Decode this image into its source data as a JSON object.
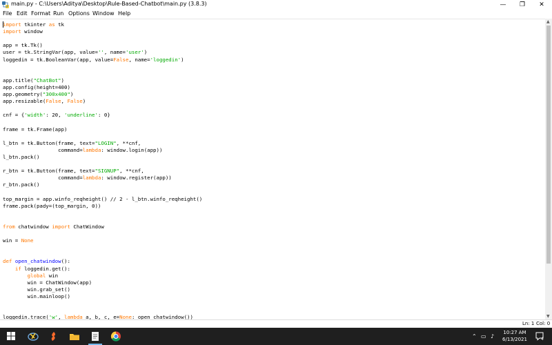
{
  "window": {
    "title": "main.py - C:\\Users\\Aditya\\Desktop\\Rule-Based-Chatbot\\main.py (3.8.3)",
    "minimize": "—",
    "maximize": "❐",
    "close": "✕"
  },
  "menu": [
    "File",
    "Edit",
    "Format",
    "Run",
    "Options",
    "Window",
    "Help"
  ],
  "code": [
    [
      {
        "t": "import",
        "c": "kw"
      },
      {
        "t": " tkinter "
      },
      {
        "t": "as",
        "c": "kw"
      },
      {
        "t": " tk"
      }
    ],
    [
      {
        "t": "import",
        "c": "kw"
      },
      {
        "t": " window"
      }
    ],
    [],
    [
      {
        "t": "app = tk.Tk()"
      }
    ],
    [
      {
        "t": "user = tk.StringVar(app, value="
      },
      {
        "t": "''",
        "c": "str"
      },
      {
        "t": ", name="
      },
      {
        "t": "'user'",
        "c": "str"
      },
      {
        "t": ")"
      }
    ],
    [
      {
        "t": "loggedin = tk.BooleanVar(app, value="
      },
      {
        "t": "False",
        "c": "kw"
      },
      {
        "t": ", name="
      },
      {
        "t": "'loggedin'",
        "c": "str"
      },
      {
        "t": ")"
      }
    ],
    [],
    [],
    [
      {
        "t": "app.title("
      },
      {
        "t": "\"ChatBot\"",
        "c": "str"
      },
      {
        "t": ")"
      }
    ],
    [
      {
        "t": "app.config(height=400)"
      }
    ],
    [
      {
        "t": "app.geometry("
      },
      {
        "t": "\"300x400\"",
        "c": "str"
      },
      {
        "t": ")"
      }
    ],
    [
      {
        "t": "app.resizable("
      },
      {
        "t": "False",
        "c": "kw"
      },
      {
        "t": ", "
      },
      {
        "t": "False",
        "c": "kw"
      },
      {
        "t": ")"
      }
    ],
    [],
    [
      {
        "t": "cnf = {"
      },
      {
        "t": "'width'",
        "c": "str"
      },
      {
        "t": ": 20, "
      },
      {
        "t": "'underline'",
        "c": "str"
      },
      {
        "t": ": 0}"
      }
    ],
    [],
    [
      {
        "t": "frame = tk.Frame(app)"
      }
    ],
    [],
    [
      {
        "t": "l_btn = tk.Button(frame, text="
      },
      {
        "t": "\"LOGIN\"",
        "c": "str"
      },
      {
        "t": ", **cnf,"
      }
    ],
    [
      {
        "t": "                  command="
      },
      {
        "t": "lambda",
        "c": "kw"
      },
      {
        "t": ": window.login(app))"
      }
    ],
    [
      {
        "t": "l_btn.pack()"
      }
    ],
    [],
    [
      {
        "t": "r_btn = tk.Button(frame, text="
      },
      {
        "t": "\"SIGNUP\"",
        "c": "str"
      },
      {
        "t": ", **cnf,"
      }
    ],
    [
      {
        "t": "                  command="
      },
      {
        "t": "lambda",
        "c": "kw"
      },
      {
        "t": ": window.register(app))"
      }
    ],
    [
      {
        "t": "r_btn.pack()"
      }
    ],
    [],
    [
      {
        "t": "top_margin = app.winfo_reqheight() // 2 - l_btn.winfo_reqheight()"
      }
    ],
    [
      {
        "t": "frame.pack(pady=(top_margin, 0))"
      }
    ],
    [],
    [],
    [
      {
        "t": "from",
        "c": "kw"
      },
      {
        "t": " chatwindow "
      },
      {
        "t": "import",
        "c": "kw"
      },
      {
        "t": " ChatWindow"
      }
    ],
    [],
    [
      {
        "t": "win = "
      },
      {
        "t": "None",
        "c": "kw"
      }
    ],
    [],
    [],
    [
      {
        "t": "def",
        "c": "kw"
      },
      {
        "t": " "
      },
      {
        "t": "open_chatwindow",
        "c": "def"
      },
      {
        "t": "():"
      }
    ],
    [
      {
        "t": "    "
      },
      {
        "t": "if",
        "c": "kw"
      },
      {
        "t": " loggedin.get():"
      }
    ],
    [
      {
        "t": "        "
      },
      {
        "t": "global",
        "c": "kw"
      },
      {
        "t": " win"
      }
    ],
    [
      {
        "t": "        win = ChatWindow(app)"
      }
    ],
    [
      {
        "t": "        win.grab_set()"
      }
    ],
    [
      {
        "t": "        win.mainloop()"
      }
    ],
    [],
    [],
    [
      {
        "t": "loggedin.trace("
      },
      {
        "t": "'w'",
        "c": "str"
      },
      {
        "t": ", "
      },
      {
        "t": "lambda",
        "c": "kw"
      },
      {
        "t": " a, b, c, e="
      },
      {
        "t": "None",
        "c": "kw"
      },
      {
        "t": ": open_chatwindow())"
      }
    ]
  ],
  "status": {
    "line": "Ln: 1",
    "col": "Col: 0"
  },
  "taskbar": {
    "time": "10:27 AM",
    "date": "6/13/2021",
    "notifications": "4",
    "accent": "#76b9ed",
    "icons": [
      "windows-start-icon",
      "search-icon",
      "task-view-icon",
      "idle-python-icon",
      "firefox-icon",
      "file-explorer-icon",
      "notepad-icon",
      "chrome-icon"
    ]
  },
  "colors": {
    "keyword": "#ff7700",
    "string": "#00aa00",
    "definition": "#0000ff"
  }
}
